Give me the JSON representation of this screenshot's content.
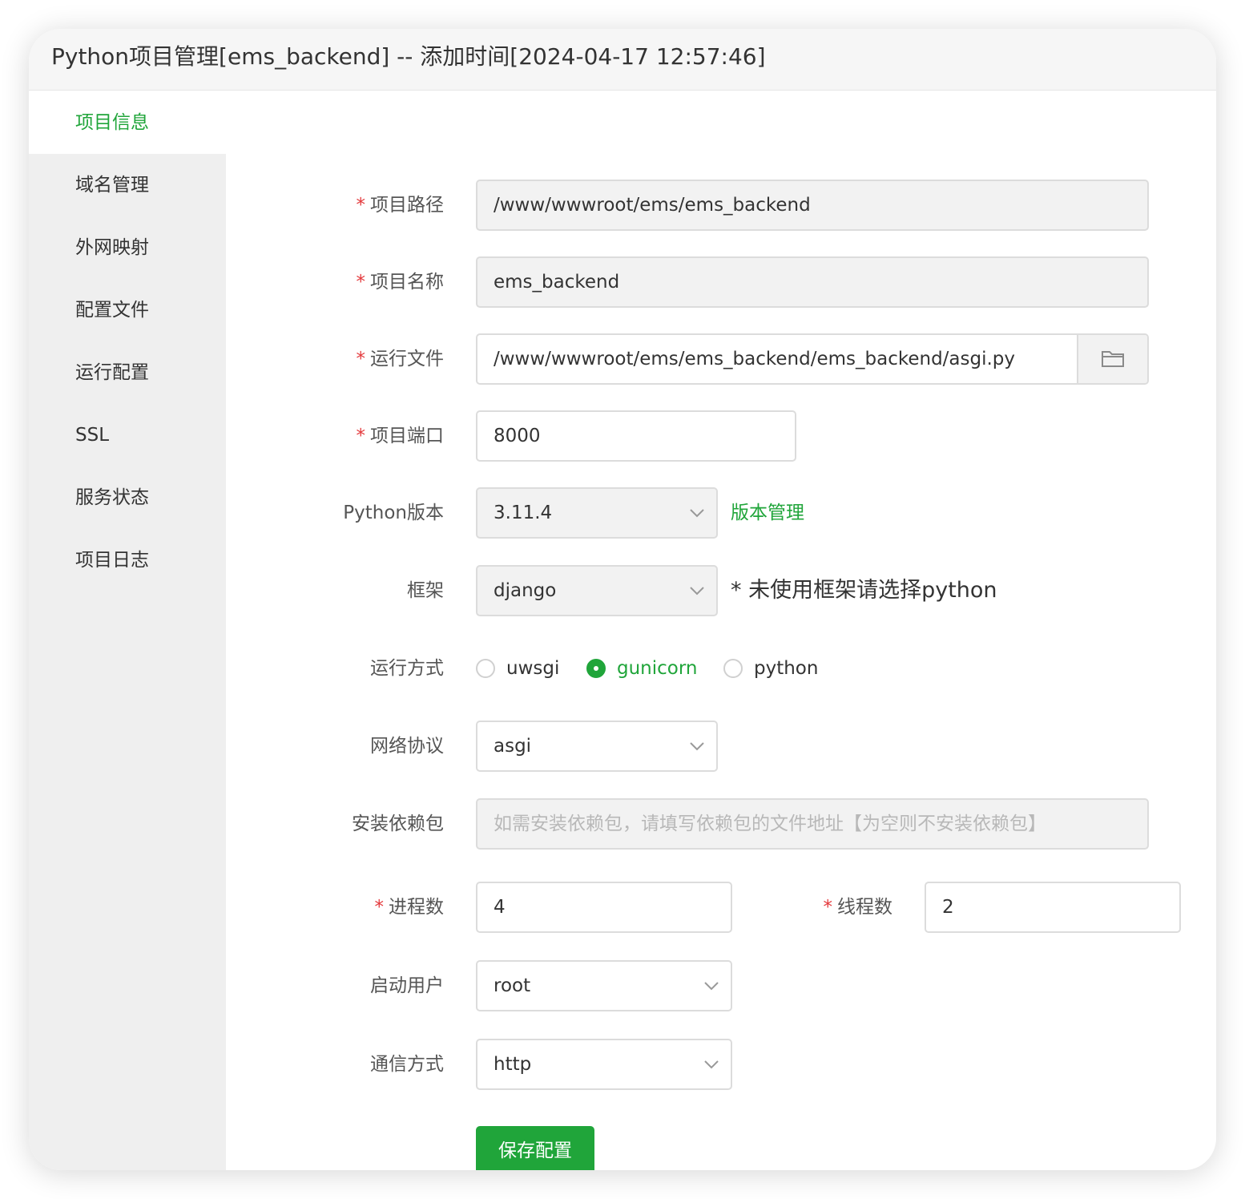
{
  "window": {
    "title": "Python项目管理[ems_backend] -- 添加时间[2024-04-17 12:57:46]"
  },
  "sidebar": {
    "items": [
      {
        "label": "项目信息"
      },
      {
        "label": "域名管理"
      },
      {
        "label": "外网映射"
      },
      {
        "label": "配置文件"
      },
      {
        "label": "运行配置"
      },
      {
        "label": "SSL"
      },
      {
        "label": "服务状态"
      },
      {
        "label": "项目日志"
      }
    ],
    "active": "项目信息"
  },
  "form": {
    "required_mark": "*",
    "project_path": {
      "label": "项目路径",
      "value": "/www/wwwroot/ems/ems_backend"
    },
    "project_name": {
      "label": "项目名称",
      "value": "ems_backend"
    },
    "run_file": {
      "label": "运行文件",
      "value": "/www/wwwroot/ems/ems_backend/ems_backend/asgi.py",
      "button_icon": "folder-icon"
    },
    "project_port": {
      "label": "项目端口",
      "value": "8000"
    },
    "python_version": {
      "label": "Python版本",
      "value": "3.11.4",
      "link": "版本管理"
    },
    "framework": {
      "label": "框架",
      "value": "django",
      "note": "* 未使用框架请选择python"
    },
    "run_mode": {
      "label": "运行方式",
      "options": [
        {
          "label": "uwsgi",
          "checked": false
        },
        {
          "label": "gunicorn",
          "checked": true
        },
        {
          "label": "python",
          "checked": false
        }
      ]
    },
    "network_protocol": {
      "label": "网络协议",
      "value": "asgi"
    },
    "install_deps": {
      "label": "安装依赖包",
      "placeholder": "如需安装依赖包，请填写依赖包的文件地址【为空则不安装依赖包】"
    },
    "processes": {
      "label": "进程数",
      "value": "4"
    },
    "threads": {
      "label": "线程数",
      "value": "2"
    },
    "start_user": {
      "label": "启动用户",
      "value": "root"
    },
    "comm_method": {
      "label": "通信方式",
      "value": "http"
    },
    "save_label": "保存配置"
  },
  "colors": {
    "accent": "#20a53a",
    "required": "#e4393c",
    "sidebar_bg": "#efefef",
    "disabled_bg": "#f2f2f2"
  }
}
